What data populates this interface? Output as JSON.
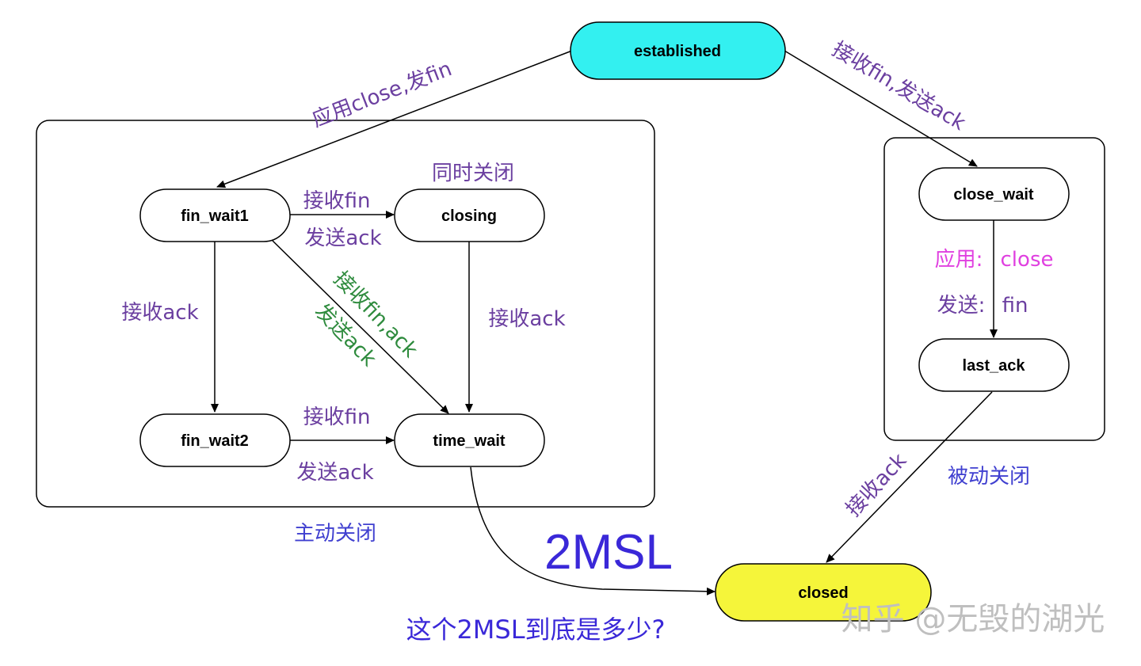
{
  "colors": {
    "purple": "#6b3fa0",
    "blue": "#4040d0",
    "green": "#2e8b3d",
    "magenta": "#e040e0",
    "established_fill": "#33f0f0",
    "closed_fill": "#f5f53a",
    "watermark": "#bfbfbf"
  },
  "states": {
    "established": "established",
    "fin_wait1": "fin_wait1",
    "closing": "closing",
    "fin_wait2": "fin_wait2",
    "time_wait": "time_wait",
    "close_wait": "close_wait",
    "last_ack": "last_ack",
    "closed": "closed"
  },
  "transitions": {
    "app_close_send_fin": "应用close,发fin",
    "recv_fin_send_ack_right": "接收fin,发送ack",
    "simultaneous_close": "同时关闭",
    "fw1_closing_recv": "接收fin",
    "fw1_closing_send": "发送ack",
    "fw1_fw2_recv_ack": "接收ack",
    "fw1_tw_recv": "接收fin,ack",
    "fw1_tw_send": "发送ack",
    "closing_tw_recv_ack": "接收ack",
    "fw2_tw_recv": "接收fin",
    "fw2_tw_send": "发送ack",
    "cw_app_prefix": "应用:",
    "cw_app_value": "close",
    "cw_send_prefix": "发送:",
    "cw_send_value": "fin",
    "la_closed_recv_ack": "接收ack"
  },
  "groups": {
    "active_close": "主动关闭",
    "passive_close": "被动关闭"
  },
  "timer": "2MSL",
  "question": "这个2MSL到底是多少?",
  "watermark": "知乎 @无毁的湖光"
}
